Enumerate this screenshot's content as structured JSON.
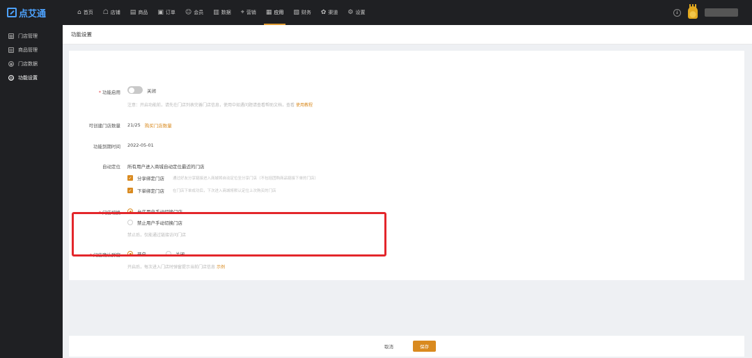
{
  "app": {
    "logo": "点艾通"
  },
  "nav": [
    {
      "label": "首页",
      "icon": "⌂"
    },
    {
      "label": "店铺",
      "icon": "☖"
    },
    {
      "label": "商品",
      "icon": "▤"
    },
    {
      "label": "订单",
      "icon": "▣"
    },
    {
      "label": "会员",
      "icon": "☺"
    },
    {
      "label": "数据",
      "icon": "▥"
    },
    {
      "label": "营销",
      "icon": "⌖"
    },
    {
      "label": "应用",
      "icon": "▦"
    },
    {
      "label": "财务",
      "icon": "▧"
    },
    {
      "label": "渠道",
      "icon": "✿"
    },
    {
      "label": "设置",
      "icon": "⚙"
    }
  ],
  "sidebar": [
    {
      "label": "门店管理",
      "icon": "▦"
    },
    {
      "label": "商品管理",
      "icon": "▤"
    },
    {
      "label": "门店数据",
      "icon": "◉"
    },
    {
      "label": "功能设置",
      "icon": "◎"
    }
  ],
  "page": {
    "title": "功能设置",
    "enable": {
      "label": "功能启用",
      "state": "关闭",
      "hint": "注意：开启功能前，请先在门店列表完善门店信息，使用中如遇问题请查看帮助文档，查看",
      "hint_link": "使用教程"
    },
    "count": {
      "label": "可创建门店数量",
      "value": "21/25",
      "link": "购买门店数量"
    },
    "expire": {
      "label": "功能到期时间",
      "value": "2022-05-01"
    },
    "auto_locate": {
      "label": "自动定位",
      "desc": "所有用户进入商城自动定位最近的门店",
      "opt1": "分享绑定门店",
      "opt1_hint": "通过好友分享链接进入商城将自动定位至分享门店（不包括团购商品链接下单的门店）",
      "opt2": "下单绑定门店",
      "opt2_hint": "在门店下单成功后，下次进入商城将默认定位上次购买的门店"
    },
    "switch_store": {
      "label": "门店切换",
      "opt1": "允许用户手动切换门店",
      "opt2": "禁止用户手动切换门店",
      "hint": "禁止后，仅能通过链接访问门店"
    },
    "confirm_popup": {
      "label": "门店确认弹窗",
      "on": "开启",
      "off": "关闭",
      "hint": "开启后，每次进入门店时弹窗提示当前门店信息",
      "hint_link": "示例"
    }
  },
  "footer": {
    "cancel": "取消",
    "save": "保存"
  }
}
